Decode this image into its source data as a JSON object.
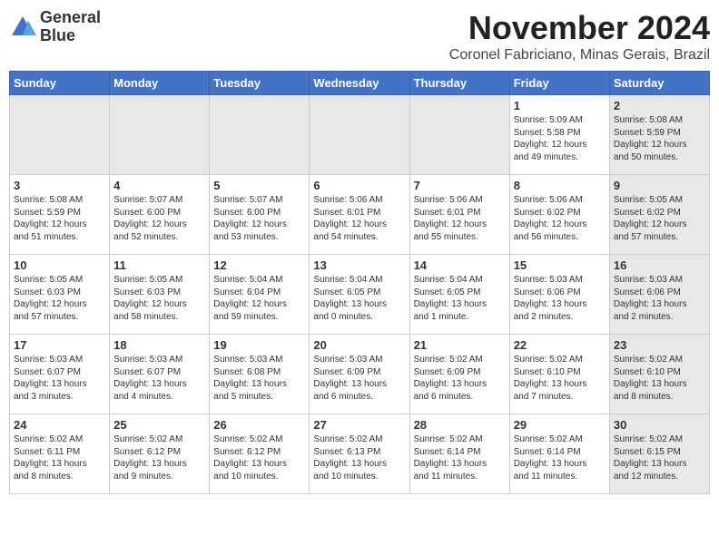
{
  "header": {
    "logo_line1": "General",
    "logo_line2": "Blue",
    "month": "November 2024",
    "location": "Coronel Fabriciano, Minas Gerais, Brazil"
  },
  "days_of_week": [
    "Sunday",
    "Monday",
    "Tuesday",
    "Wednesday",
    "Thursday",
    "Friday",
    "Saturday"
  ],
  "weeks": [
    [
      {
        "day": "",
        "info": "",
        "shaded": true
      },
      {
        "day": "",
        "info": "",
        "shaded": true
      },
      {
        "day": "",
        "info": "",
        "shaded": true
      },
      {
        "day": "",
        "info": "",
        "shaded": true
      },
      {
        "day": "",
        "info": "",
        "shaded": true
      },
      {
        "day": "1",
        "info": "Sunrise: 5:09 AM\nSunset: 5:58 PM\nDaylight: 12 hours\nand 49 minutes.",
        "shaded": false
      },
      {
        "day": "2",
        "info": "Sunrise: 5:08 AM\nSunset: 5:59 PM\nDaylight: 12 hours\nand 50 minutes.",
        "shaded": true
      }
    ],
    [
      {
        "day": "3",
        "info": "Sunrise: 5:08 AM\nSunset: 5:59 PM\nDaylight: 12 hours\nand 51 minutes.",
        "shaded": false
      },
      {
        "day": "4",
        "info": "Sunrise: 5:07 AM\nSunset: 6:00 PM\nDaylight: 12 hours\nand 52 minutes.",
        "shaded": false
      },
      {
        "day": "5",
        "info": "Sunrise: 5:07 AM\nSunset: 6:00 PM\nDaylight: 12 hours\nand 53 minutes.",
        "shaded": false
      },
      {
        "day": "6",
        "info": "Sunrise: 5:06 AM\nSunset: 6:01 PM\nDaylight: 12 hours\nand 54 minutes.",
        "shaded": false
      },
      {
        "day": "7",
        "info": "Sunrise: 5:06 AM\nSunset: 6:01 PM\nDaylight: 12 hours\nand 55 minutes.",
        "shaded": false
      },
      {
        "day": "8",
        "info": "Sunrise: 5:06 AM\nSunset: 6:02 PM\nDaylight: 12 hours\nand 56 minutes.",
        "shaded": false
      },
      {
        "day": "9",
        "info": "Sunrise: 5:05 AM\nSunset: 6:02 PM\nDaylight: 12 hours\nand 57 minutes.",
        "shaded": true
      }
    ],
    [
      {
        "day": "10",
        "info": "Sunrise: 5:05 AM\nSunset: 6:03 PM\nDaylight: 12 hours\nand 57 minutes.",
        "shaded": false
      },
      {
        "day": "11",
        "info": "Sunrise: 5:05 AM\nSunset: 6:03 PM\nDaylight: 12 hours\nand 58 minutes.",
        "shaded": false
      },
      {
        "day": "12",
        "info": "Sunrise: 5:04 AM\nSunset: 6:04 PM\nDaylight: 12 hours\nand 59 minutes.",
        "shaded": false
      },
      {
        "day": "13",
        "info": "Sunrise: 5:04 AM\nSunset: 6:05 PM\nDaylight: 13 hours\nand 0 minutes.",
        "shaded": false
      },
      {
        "day": "14",
        "info": "Sunrise: 5:04 AM\nSunset: 6:05 PM\nDaylight: 13 hours\nand 1 minute.",
        "shaded": false
      },
      {
        "day": "15",
        "info": "Sunrise: 5:03 AM\nSunset: 6:06 PM\nDaylight: 13 hours\nand 2 minutes.",
        "shaded": false
      },
      {
        "day": "16",
        "info": "Sunrise: 5:03 AM\nSunset: 6:06 PM\nDaylight: 13 hours\nand 2 minutes.",
        "shaded": true
      }
    ],
    [
      {
        "day": "17",
        "info": "Sunrise: 5:03 AM\nSunset: 6:07 PM\nDaylight: 13 hours\nand 3 minutes.",
        "shaded": false
      },
      {
        "day": "18",
        "info": "Sunrise: 5:03 AM\nSunset: 6:07 PM\nDaylight: 13 hours\nand 4 minutes.",
        "shaded": false
      },
      {
        "day": "19",
        "info": "Sunrise: 5:03 AM\nSunset: 6:08 PM\nDaylight: 13 hours\nand 5 minutes.",
        "shaded": false
      },
      {
        "day": "20",
        "info": "Sunrise: 5:03 AM\nSunset: 6:09 PM\nDaylight: 13 hours\nand 6 minutes.",
        "shaded": false
      },
      {
        "day": "21",
        "info": "Sunrise: 5:02 AM\nSunset: 6:09 PM\nDaylight: 13 hours\nand 6 minutes.",
        "shaded": false
      },
      {
        "day": "22",
        "info": "Sunrise: 5:02 AM\nSunset: 6:10 PM\nDaylight: 13 hours\nand 7 minutes.",
        "shaded": false
      },
      {
        "day": "23",
        "info": "Sunrise: 5:02 AM\nSunset: 6:10 PM\nDaylight: 13 hours\nand 8 minutes.",
        "shaded": true
      }
    ],
    [
      {
        "day": "24",
        "info": "Sunrise: 5:02 AM\nSunset: 6:11 PM\nDaylight: 13 hours\nand 8 minutes.",
        "shaded": false
      },
      {
        "day": "25",
        "info": "Sunrise: 5:02 AM\nSunset: 6:12 PM\nDaylight: 13 hours\nand 9 minutes.",
        "shaded": false
      },
      {
        "day": "26",
        "info": "Sunrise: 5:02 AM\nSunset: 6:12 PM\nDaylight: 13 hours\nand 10 minutes.",
        "shaded": false
      },
      {
        "day": "27",
        "info": "Sunrise: 5:02 AM\nSunset: 6:13 PM\nDaylight: 13 hours\nand 10 minutes.",
        "shaded": false
      },
      {
        "day": "28",
        "info": "Sunrise: 5:02 AM\nSunset: 6:14 PM\nDaylight: 13 hours\nand 11 minutes.",
        "shaded": false
      },
      {
        "day": "29",
        "info": "Sunrise: 5:02 AM\nSunset: 6:14 PM\nDaylight: 13 hours\nand 11 minutes.",
        "shaded": false
      },
      {
        "day": "30",
        "info": "Sunrise: 5:02 AM\nSunset: 6:15 PM\nDaylight: 13 hours\nand 12 minutes.",
        "shaded": true
      }
    ]
  ]
}
